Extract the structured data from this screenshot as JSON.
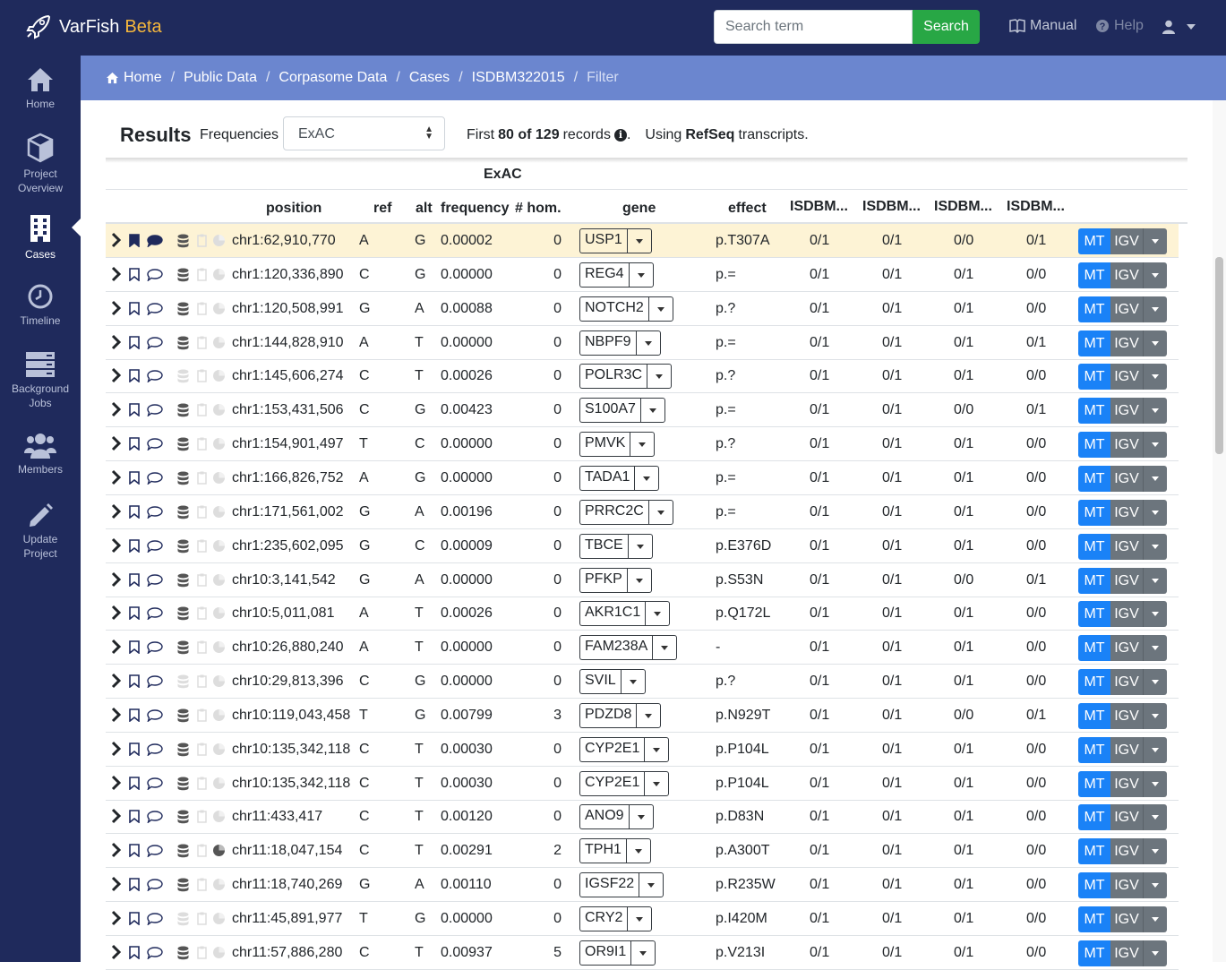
{
  "app": {
    "name": "VarFish",
    "badge": "Beta"
  },
  "search": {
    "placeholder": "Search term",
    "button": "Search"
  },
  "nav": {
    "manual": "Manual",
    "help": "Help"
  },
  "sidebar": [
    {
      "label": "Home",
      "icon": "home-icon"
    },
    {
      "label": "Project",
      "label2": "Overview",
      "icon": "cube-icon"
    },
    {
      "label": "Cases",
      "icon": "building-icon",
      "active": true
    },
    {
      "label": "Timeline",
      "icon": "clock-icon"
    },
    {
      "label": "Background",
      "label2": "Jobs",
      "icon": "server-icon"
    },
    {
      "label": "Members",
      "icon": "users-icon"
    },
    {
      "label": "Update",
      "label2": "Project",
      "icon": "pencil-icon"
    }
  ],
  "breadcrumb": [
    "Home",
    "Public Data",
    "Corpasome Data",
    "Cases",
    "ISDBM322015",
    "Filter"
  ],
  "results": {
    "title": "Results",
    "frequencies_label": "Frequencies",
    "frequencies_value": "ExAC",
    "records_prefix": "First",
    "records_bold": "80 of 129",
    "records_suffix": "records",
    "using_prefix": "Using",
    "using_bold": "RefSeq",
    "using_suffix": "transcripts."
  },
  "table": {
    "group_header": "ExAC",
    "columns": {
      "position": "position",
      "ref": "ref",
      "alt": "alt",
      "frequency": "frequency",
      "hom": "# hom.",
      "gene": "gene",
      "effect": "effect",
      "g1": "ISDBM...",
      "g2": "ISDBM...",
      "g3": "ISDBM...",
      "g4": "ISDBM..."
    },
    "button_mt": "MT",
    "button_igv": "IGV",
    "rows": [
      {
        "pos": "chr1:62,910,770",
        "ref": "A",
        "alt": "G",
        "freq": "0.00002",
        "hom": "0",
        "gene": "USP1",
        "effect": "p.T307A",
        "gt": [
          "0/1",
          "0/1",
          "0/0",
          "0/1"
        ],
        "flagged": true,
        "db": true
      },
      {
        "pos": "chr1:120,336,890",
        "ref": "C",
        "alt": "G",
        "freq": "0.00000",
        "hom": "0",
        "gene": "REG4",
        "effect": "p.=",
        "gt": [
          "0/1",
          "0/1",
          "0/1",
          "0/0"
        ],
        "db": true
      },
      {
        "pos": "chr1:120,508,991",
        "ref": "G",
        "alt": "A",
        "freq": "0.00088",
        "hom": "0",
        "gene": "NOTCH2",
        "effect": "p.?",
        "gt": [
          "0/1",
          "0/1",
          "0/1",
          "0/0"
        ],
        "db": true
      },
      {
        "pos": "chr1:144,828,910",
        "ref": "A",
        "alt": "T",
        "freq": "0.00000",
        "hom": "0",
        "gene": "NBPF9",
        "effect": "p.=",
        "gt": [
          "0/1",
          "0/1",
          "0/1",
          "0/1"
        ],
        "db": true
      },
      {
        "pos": "chr1:145,606,274",
        "ref": "C",
        "alt": "T",
        "freq": "0.00026",
        "hom": "0",
        "gene": "POLR3C",
        "effect": "p.?",
        "gt": [
          "0/1",
          "0/1",
          "0/1",
          "0/0"
        ],
        "db": false
      },
      {
        "pos": "chr1:153,431,506",
        "ref": "C",
        "alt": "G",
        "freq": "0.00423",
        "hom": "0",
        "gene": "S100A7",
        "effect": "p.=",
        "gt": [
          "0/1",
          "0/1",
          "0/0",
          "0/1"
        ],
        "db": true
      },
      {
        "pos": "chr1:154,901,497",
        "ref": "T",
        "alt": "C",
        "freq": "0.00000",
        "hom": "0",
        "gene": "PMVK",
        "effect": "p.?",
        "gt": [
          "0/1",
          "0/1",
          "0/1",
          "0/0"
        ],
        "db": true
      },
      {
        "pos": "chr1:166,826,752",
        "ref": "A",
        "alt": "G",
        "freq": "0.00000",
        "hom": "0",
        "gene": "TADA1",
        "effect": "p.=",
        "gt": [
          "0/1",
          "0/1",
          "0/1",
          "0/0"
        ],
        "db": true
      },
      {
        "pos": "chr1:171,561,002",
        "ref": "G",
        "alt": "A",
        "freq": "0.00196",
        "hom": "0",
        "gene": "PRRC2C",
        "effect": "p.=",
        "gt": [
          "0/1",
          "0/1",
          "0/1",
          "0/0"
        ],
        "db": true
      },
      {
        "pos": "chr1:235,602,095",
        "ref": "G",
        "alt": "C",
        "freq": "0.00009",
        "hom": "0",
        "gene": "TBCE",
        "effect": "p.E376D",
        "gt": [
          "0/1",
          "0/1",
          "0/1",
          "0/0"
        ],
        "db": true
      },
      {
        "pos": "chr10:3,141,542",
        "ref": "G",
        "alt": "A",
        "freq": "0.00000",
        "hom": "0",
        "gene": "PFKP",
        "effect": "p.S53N",
        "gt": [
          "0/1",
          "0/1",
          "0/0",
          "0/1"
        ],
        "db": true
      },
      {
        "pos": "chr10:5,011,081",
        "ref": "A",
        "alt": "T",
        "freq": "0.00026",
        "hom": "0",
        "gene": "AKR1C1",
        "effect": "p.Q172L",
        "gt": [
          "0/1",
          "0/1",
          "0/1",
          "0/0"
        ],
        "db": true
      },
      {
        "pos": "chr10:26,880,240",
        "ref": "A",
        "alt": "T",
        "freq": "0.00000",
        "hom": "0",
        "gene": "FAM238A",
        "effect": "-",
        "gt": [
          "0/1",
          "0/1",
          "0/1",
          "0/0"
        ],
        "db": true
      },
      {
        "pos": "chr10:29,813,396",
        "ref": "C",
        "alt": "G",
        "freq": "0.00000",
        "hom": "0",
        "gene": "SVIL",
        "effect": "p.?",
        "gt": [
          "0/1",
          "0/1",
          "0/1",
          "0/0"
        ],
        "db": false
      },
      {
        "pos": "chr10:119,043,458",
        "ref": "T",
        "alt": "G",
        "freq": "0.00799",
        "hom": "3",
        "gene": "PDZD8",
        "effect": "p.N929T",
        "gt": [
          "0/1",
          "0/1",
          "0/0",
          "0/1"
        ],
        "db": true
      },
      {
        "pos": "chr10:135,342,118",
        "ref": "C",
        "alt": "T",
        "freq": "0.00030",
        "hom": "0",
        "gene": "CYP2E1",
        "effect": "p.P104L",
        "gt": [
          "0/1",
          "0/1",
          "0/1",
          "0/0"
        ],
        "db": true
      },
      {
        "pos": "chr10:135,342,118",
        "ref": "C",
        "alt": "T",
        "freq": "0.00030",
        "hom": "0",
        "gene": "CYP2E1",
        "effect": "p.P104L",
        "gt": [
          "0/1",
          "0/1",
          "0/1",
          "0/0"
        ],
        "db": true
      },
      {
        "pos": "chr11:433,417",
        "ref": "C",
        "alt": "T",
        "freq": "0.00120",
        "hom": "0",
        "gene": "ANO9",
        "effect": "p.D83N",
        "gt": [
          "0/1",
          "0/1",
          "0/1",
          "0/0"
        ],
        "db": true
      },
      {
        "pos": "chr11:18,047,154",
        "ref": "C",
        "alt": "T",
        "freq": "0.00291",
        "hom": "2",
        "gene": "TPH1",
        "effect": "p.A300T",
        "gt": [
          "0/1",
          "0/1",
          "0/1",
          "0/0"
        ],
        "db": true,
        "pie": true
      },
      {
        "pos": "chr11:18,740,269",
        "ref": "G",
        "alt": "A",
        "freq": "0.00110",
        "hom": "0",
        "gene": "IGSF22",
        "effect": "p.R235W",
        "gt": [
          "0/1",
          "0/1",
          "0/1",
          "0/0"
        ],
        "db": true
      },
      {
        "pos": "chr11:45,891,977",
        "ref": "T",
        "alt": "G",
        "freq": "0.00000",
        "hom": "0",
        "gene": "CRY2",
        "effect": "p.I420M",
        "gt": [
          "0/1",
          "0/1",
          "0/1",
          "0/0"
        ],
        "db": false
      },
      {
        "pos": "chr11:57,886,280",
        "ref": "C",
        "alt": "T",
        "freq": "0.00937",
        "hom": "5",
        "gene": "OR9I1",
        "effect": "p.V213I",
        "gt": [
          "0/1",
          "0/1",
          "0/1",
          "0/0"
        ],
        "db": true
      }
    ]
  },
  "colors": {
    "navbar": "#1f2a5c",
    "breadcrumb": "#6b86cf",
    "search_button": "#28a745",
    "mt_button": "#1a82f7",
    "igv_button": "#6c757d",
    "highlight_row": "#fdf3d5",
    "beta": "#f6b73c"
  }
}
